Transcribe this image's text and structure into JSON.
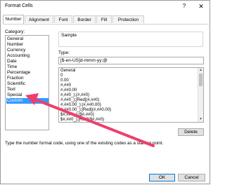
{
  "window": {
    "title": "Format Cells",
    "help_glyph": "?",
    "close_glyph": "✕"
  },
  "tabs": [
    {
      "label": "Number",
      "active": true
    },
    {
      "label": "Alignment",
      "active": false
    },
    {
      "label": "Font",
      "active": false
    },
    {
      "label": "Border",
      "active": false
    },
    {
      "label": "Fill",
      "active": false
    },
    {
      "label": "Protection",
      "active": false
    }
  ],
  "category": {
    "label": "Category:",
    "items": [
      "General",
      "Number",
      "Currency",
      "Accounting",
      "Date",
      "Time",
      "Percentage",
      "Fraction",
      "Scientific",
      "Text",
      "Special",
      "Custom"
    ],
    "selected": "Custom"
  },
  "sample": {
    "label": "Sample"
  },
  "type": {
    "label": "Type:",
    "value": "[$-en-US]d-mmm-yy;@"
  },
  "formats": [
    "General",
    "0",
    "0.00",
    "#,##0",
    "#,##0.00",
    "#,##0_);(#,##0)",
    "#,##0_);[Red](#,##0)",
    "#,##0.00_);(#,##0.00)",
    "#,##0.00_);[Red](#,##0.00)",
    "$#,##0_);($#,##0)",
    "$#,##0_);[Red]($#,##0)"
  ],
  "buttons": {
    "delete": "Delete",
    "ok": "OK",
    "cancel": "Cancel"
  },
  "hint": "Type the number format code, using one of the existing codes as a starting point.",
  "colors": {
    "selection": "#3399ff",
    "annotation_arrow": "#ee3f6b"
  }
}
